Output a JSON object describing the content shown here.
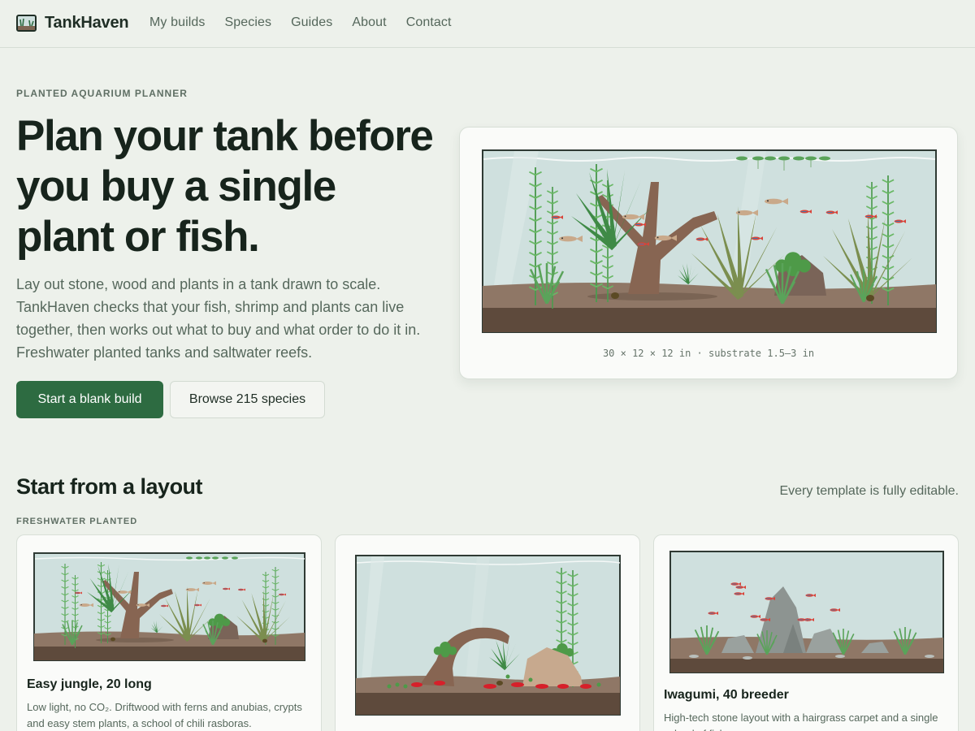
{
  "brand": {
    "name": "TankHaven",
    "icon": "tank-logo-icon"
  },
  "nav": [
    {
      "label": "My builds"
    },
    {
      "label": "Species"
    },
    {
      "label": "Guides"
    },
    {
      "label": "About"
    },
    {
      "label": "Contact"
    }
  ],
  "hero": {
    "eyebrow": "PLANTED AQUARIUM PLANNER",
    "title": "Plan your tank before you buy a single plant or fish.",
    "description": "Lay out stone, wood and plants in a tank drawn to scale. TankHaven checks that your fish, shrimp and plants can live together, then works out what to buy and what order to do it in. Freshwater planted tanks and saltwater reefs.",
    "primary_button": "Start a blank build",
    "secondary_button": "Browse 215 species",
    "tank_caption": "30 × 12 × 12 in · substrate 1.5–3 in"
  },
  "templates": {
    "title": "Start from a layout",
    "note": "Every template is fully editable.",
    "group_label": "FRESHWATER PLANTED",
    "cards": [
      {
        "title": "Easy jungle, 20 long",
        "description": "Low light, no CO₂. Driftwood with ferns and anubias, crypts and easy stem plants, a school of chili rasboras."
      },
      {
        "title": "",
        "description": ""
      },
      {
        "title": "Iwagumi, 40 breeder",
        "description": "High-tech stone layout with a hairgrass carpet and a single school of fish."
      }
    ]
  },
  "colors": {
    "background": "#edf1eb",
    "accent": "#2d6b41",
    "water": "#cfe0de",
    "substrate": "#8f7766"
  }
}
